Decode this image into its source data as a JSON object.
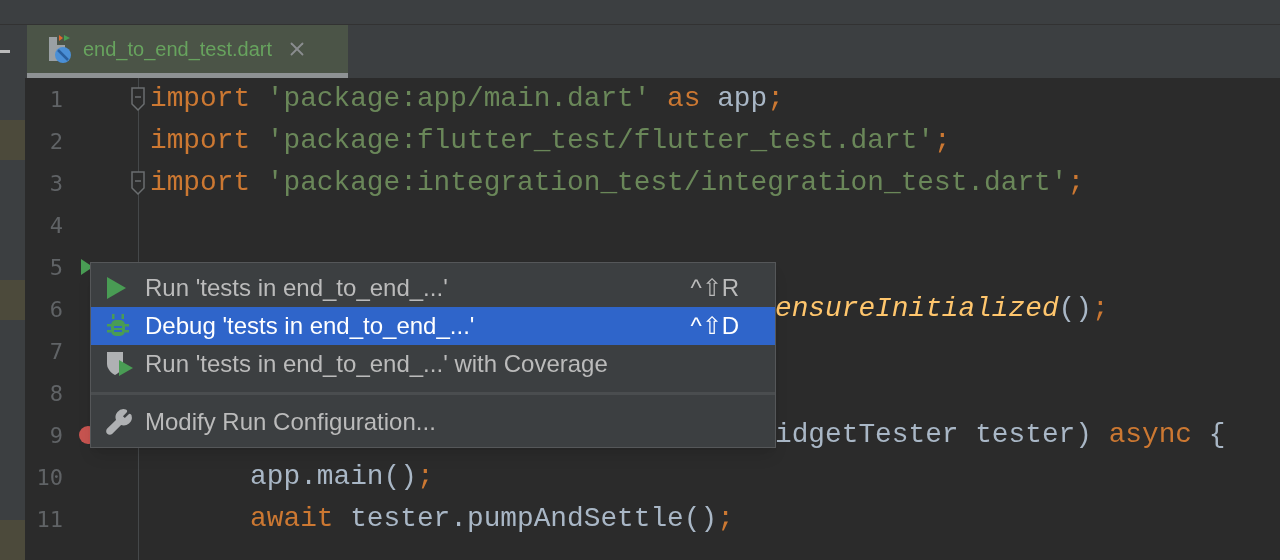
{
  "tab": {
    "label": "end_to_end_test.dart",
    "selected": true
  },
  "lines": [
    {
      "number": "1",
      "kind": "fold",
      "tokens": [
        {
          "text": "import",
          "kind": "keyword"
        },
        {
          "text": " 'package:app/main.dart'",
          "kind": "string"
        },
        {
          "text": " as",
          "kind": "keyword"
        },
        {
          "text": " app",
          "kind": "plain"
        },
        {
          "text": ";",
          "kind": "keyword"
        }
      ]
    },
    {
      "number": "2",
      "kind": "code",
      "tokens": [
        {
          "text": "import",
          "kind": "keyword"
        },
        {
          "text": " 'package:flutter_test/flutter_test.dart'",
          "kind": "string"
        },
        {
          "text": ";",
          "kind": "keyword"
        }
      ]
    },
    {
      "number": "3",
      "kind": "fold",
      "tokens": [
        {
          "text": "import",
          "kind": "keyword"
        },
        {
          "text": " 'package:integration_test/integration_test.dart'",
          "kind": "string"
        },
        {
          "text": ";",
          "kind": "keyword"
        }
      ]
    },
    {
      "number": "4",
      "kind": "blank"
    },
    {
      "number": "5",
      "kind": "run"
    },
    {
      "number": "6",
      "kind": "covered",
      "tokens": [
        {
          "text": "ensureInitialized",
          "kind": "function"
        },
        {
          "text": "()",
          "kind": "plain"
        },
        {
          "text": ";",
          "kind": "keyword"
        }
      ]
    },
    {
      "number": "7",
      "kind": "blank"
    },
    {
      "number": "8",
      "kind": "blank"
    },
    {
      "number": "9",
      "kind": "error-covered",
      "tokens": [
        {
          "text": "idgetTester tester) ",
          "kind": "plain"
        },
        {
          "text": "async",
          "kind": "keyword"
        },
        {
          "text": " {",
          "kind": "plain"
        }
      ]
    },
    {
      "number": "10",
      "kind": "code",
      "tokens": [
        {
          "text": "      app.main()",
          "kind": "plain"
        },
        {
          "text": ";",
          "kind": "keyword"
        }
      ]
    },
    {
      "number": "11",
      "kind": "code",
      "tokens": [
        {
          "text": "      await",
          "kind": "keyword"
        },
        {
          "text": " tester.pumpAndSettle()",
          "kind": "plain"
        },
        {
          "text": ";",
          "kind": "keyword"
        }
      ]
    }
  ],
  "menu": [
    {
      "kind": "item",
      "label": "Run 'tests in end_to_end_...'",
      "shortcut": "^⇧R",
      "selected": false
    },
    {
      "kind": "item",
      "label": "Debug 'tests in end_to_end_...'",
      "shortcut": "^⇧D",
      "selected": true
    },
    {
      "kind": "item",
      "label": "Run 'tests in end_to_end_...' with Coverage",
      "selected": false
    },
    {
      "kind": "separator"
    },
    {
      "kind": "item",
      "label": "Modify Run Configuration...",
      "selected": false
    }
  ]
}
